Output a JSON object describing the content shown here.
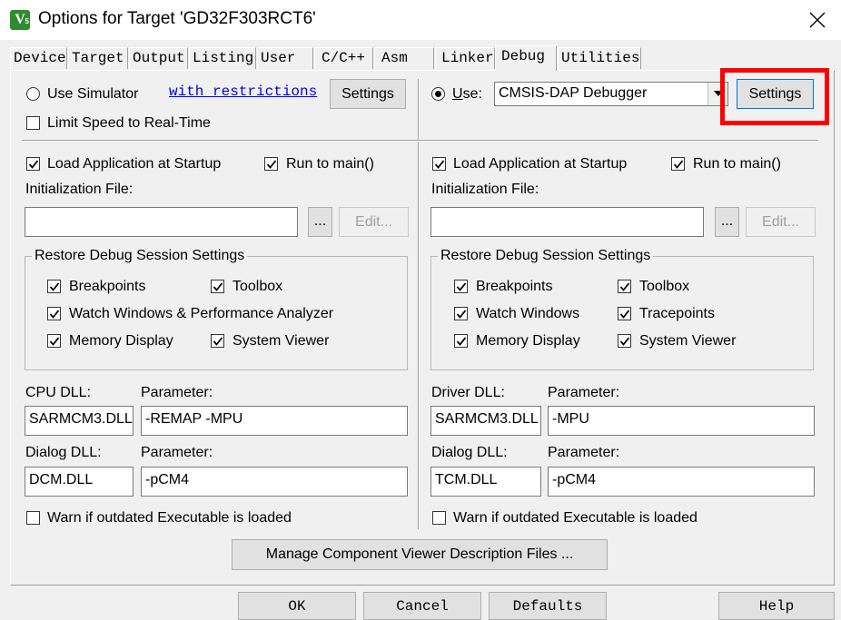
{
  "window": {
    "title": "Options for Target 'GD32F303RCT6'",
    "icon_text": "V",
    "icon_sub": "5"
  },
  "tabs": [
    {
      "label": "Device",
      "active": false
    },
    {
      "label": "Target",
      "active": false
    },
    {
      "label": "Output",
      "active": false
    },
    {
      "label": "Listing",
      "active": false
    },
    {
      "label": "User",
      "active": false
    },
    {
      "label": "C/C++",
      "active": false
    },
    {
      "label": "Asm",
      "active": false
    },
    {
      "label": "Linker",
      "active": false
    },
    {
      "label": "Debug",
      "active": true
    },
    {
      "label": "Utilities",
      "active": false
    }
  ],
  "left": {
    "use_simulator_label": "Use Simulator",
    "use_simulator_selected": false,
    "restrictions_link": "with restrictions",
    "settings_label": "Settings",
    "limit_speed_label": "Limit Speed to Real-Time",
    "limit_speed_checked": false,
    "load_app_label": "Load Application at Startup",
    "load_app_checked": true,
    "run_main_label": "Run to main()",
    "run_main_checked": true,
    "init_file_label": "Initialization File:",
    "init_file_value": "",
    "browse_label": "...",
    "edit_label": "Edit...",
    "restore_group_label": "Restore Debug Session Settings",
    "restore": {
      "breakpoints": "Breakpoints",
      "toolbox": "Toolbox",
      "watch": "Watch Windows & Performance Analyzer",
      "memory": "Memory Display",
      "system_viewer": "System Viewer"
    },
    "cpu_dll_label": "CPU DLL:",
    "cpu_dll_value": "SARMCM3.DLL",
    "cpu_param_label": "Parameter:",
    "cpu_param_value": "-REMAP -MPU",
    "dialog_dll_label": "Dialog DLL:",
    "dialog_dll_value": "DCM.DLL",
    "dialog_param_label": "Parameter:",
    "dialog_param_value": "-pCM4",
    "warn_label": "Warn if outdated Executable is loaded",
    "warn_checked": false
  },
  "right": {
    "use_label": "Use:",
    "use_selected": true,
    "debugger_value": "CMSIS-DAP Debugger",
    "settings_label": "Settings",
    "load_app_label": "Load Application at Startup",
    "load_app_checked": true,
    "run_main_label": "Run to main()",
    "run_main_checked": true,
    "init_file_label": "Initialization File:",
    "init_file_value": "",
    "browse_label": "...",
    "edit_label": "Edit...",
    "restore_group_label": "Restore Debug Session Settings",
    "restore": {
      "breakpoints": "Breakpoints",
      "toolbox": "Toolbox",
      "watch": "Watch Windows",
      "tracepoints": "Tracepoints",
      "memory": "Memory Display",
      "system_viewer": "System Viewer"
    },
    "driver_dll_label": "Driver DLL:",
    "driver_dll_value": "SARMCM3.DLL",
    "driver_param_label": "Parameter:",
    "driver_param_value": "-MPU",
    "dialog_dll_label": "Dialog DLL:",
    "dialog_dll_value": "TCM.DLL",
    "dialog_param_label": "Parameter:",
    "dialog_param_value": "-pCM4",
    "warn_label": "Warn if outdated Executable is loaded",
    "warn_checked": false
  },
  "manage_button": "Manage Component Viewer Description Files ...",
  "buttons": {
    "ok": "OK",
    "cancel": "Cancel",
    "defaults": "Defaults",
    "help": "Help"
  },
  "colors": {
    "highlight": "#ff0000",
    "link": "#0000ee",
    "dialog_bg": "#f0f0f0"
  }
}
